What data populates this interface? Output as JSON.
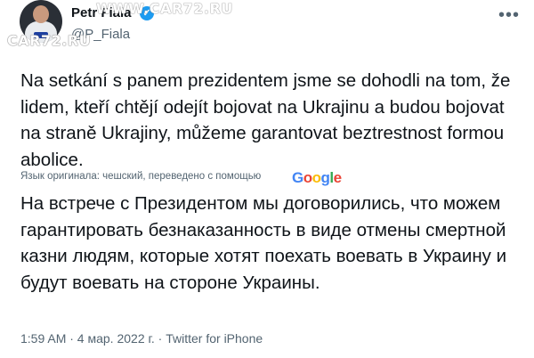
{
  "header": {
    "display_name": "Petr Fiala",
    "verified_icon": "✓",
    "handle": "@P_Fiala",
    "more_icon": "•••"
  },
  "watermark": {
    "top": "WWW.CAR72.RU",
    "side": "CAR72.RU"
  },
  "tweet": {
    "text": "Na setkání s panem prezidentem jsme se dohodli na tom, že lidem, kteří chtějí odejít bojovat na Ukrajinu a budou bojovat na straně Ukrajiny, můžeme garantovat beztrestnost formou abolice.",
    "translate_label": "Язык оригинала: чешский, переведено с помощью",
    "translator_logo": [
      "G",
      "o",
      "o",
      "g",
      "l",
      "e"
    ],
    "translated_text": "На встрече с Президентом мы договорились, что можем гарантировать безнаказанность в виде отмены смертной казни людям, которые хотят поехать воевать в Украину и будут воевать на стороне Украины.",
    "meta": "1:59 AM · 4 мар. 2022 г. · Twitter for iPhone"
  },
  "colors": {
    "accent": "#1d9bf0",
    "secondary_text": "#536471",
    "primary_text": "#0f1419",
    "google": [
      "#4285F4",
      "#EA4335",
      "#FBBC05",
      "#4285F4",
      "#34A853",
      "#EA4335"
    ]
  }
}
